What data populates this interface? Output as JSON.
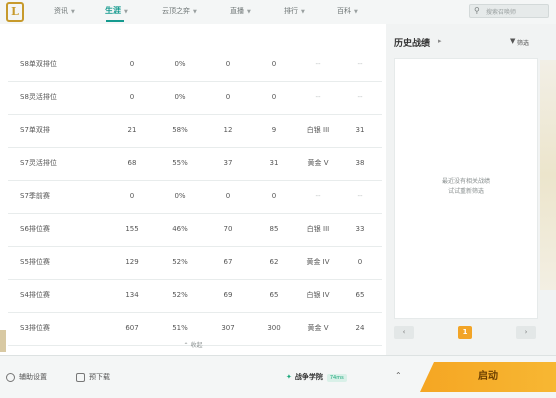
{
  "nav": {
    "logo": "L",
    "items": [
      {
        "label": "资讯"
      },
      {
        "label": "生涯"
      },
      {
        "label": "云顶之弈"
      },
      {
        "label": "直播"
      },
      {
        "label": "排行"
      },
      {
        "label": "百科"
      }
    ],
    "search_placeholder": "搜索召唤师"
  },
  "table": {
    "rows": [
      {
        "name": "S8单双排位",
        "games": "0",
        "rate": "0%",
        "wins": "0",
        "losses": "0",
        "tier": "--",
        "points": "--"
      },
      {
        "name": "S8灵活排位",
        "games": "0",
        "rate": "0%",
        "wins": "0",
        "losses": "0",
        "tier": "--",
        "points": "--"
      },
      {
        "name": "S7单双排",
        "games": "21",
        "rate": "58%",
        "wins": "12",
        "losses": "9",
        "tier": "白银 III",
        "points": "31"
      },
      {
        "name": "S7灵活排位",
        "games": "68",
        "rate": "55%",
        "wins": "37",
        "losses": "31",
        "tier": "黄金 V",
        "points": "38"
      },
      {
        "name": "S7季前赛",
        "games": "0",
        "rate": "0%",
        "wins": "0",
        "losses": "0",
        "tier": "--",
        "points": "--"
      },
      {
        "name": "S6排位赛",
        "games": "155",
        "rate": "46%",
        "wins": "70",
        "losses": "85",
        "tier": "白银 III",
        "points": "33"
      },
      {
        "name": "S5排位赛",
        "games": "129",
        "rate": "52%",
        "wins": "67",
        "losses": "62",
        "tier": "黄金 IV",
        "points": "0"
      },
      {
        "name": "S4排位赛",
        "games": "134",
        "rate": "52%",
        "wins": "69",
        "losses": "65",
        "tier": "白银 IV",
        "points": "65"
      },
      {
        "name": "S3排位赛",
        "games": "607",
        "rate": "51%",
        "wins": "307",
        "losses": "300",
        "tier": "黄金 V",
        "points": "24"
      }
    ],
    "footnote": "收起"
  },
  "history": {
    "title": "历史战绩",
    "filter": "筛选",
    "empty_line1": "最近没有相关战绩",
    "empty_line2": "试试重新筛选",
    "current_page": "1"
  },
  "bottom": {
    "assist": "辅助设置",
    "download": "预下载",
    "server": "战争学院",
    "ping": "74ms",
    "launch": "启动"
  },
  "colors": {
    "accent": "#159a8f",
    "launch": "#f5a623",
    "page_active": "#f2a427"
  }
}
